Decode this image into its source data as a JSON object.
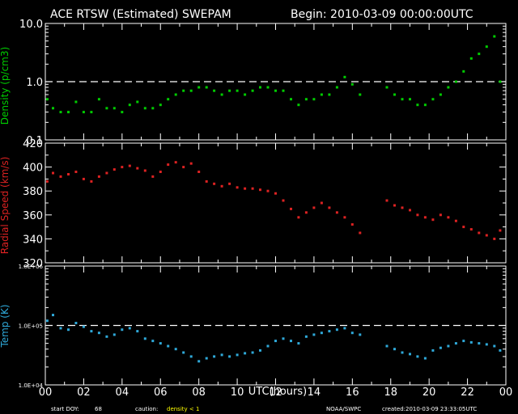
{
  "header": {
    "title": "ACE RTSW (Estimated) SWEPAM",
    "begin": "Begin: 2010-03-09 00:00:00UTC"
  },
  "footer": {
    "start_doy_label": "start DOY:",
    "start_doy_value": "68",
    "caution_label": "caution:",
    "caution_value": "density < 1",
    "source": "NOAA/SWPC",
    "created": "created:2010-03-09 23:33:05UTC"
  },
  "colors": {
    "density": "#00cc00",
    "speed": "#dd2222",
    "temp": "#2fa9d9",
    "caution": "#ffff00",
    "axes": "#ffffff"
  },
  "chart_data": [
    {
      "type": "scatter",
      "ylabel": "Density (p/cm3)",
      "yscale": "log",
      "ylim": [
        0.1,
        10.0
      ],
      "yticks": [
        0.1,
        1.0,
        10.0
      ],
      "ytick_labels": [
        "0.1",
        "1.0",
        "10.0"
      ],
      "xlim": [
        0,
        24
      ],
      "reference_line": 1.0,
      "series": [
        {
          "x": [
            0.1,
            0.4,
            0.8,
            1.2,
            1.6,
            2.0,
            2.4,
            2.8,
            3.2,
            3.6,
            4.0,
            4.4,
            4.8,
            5.2,
            5.6,
            6.0,
            6.4,
            6.8,
            7.2,
            7.6,
            8.0,
            8.4,
            8.8,
            9.2,
            9.6,
            10.0,
            10.4,
            10.8,
            11.2,
            11.6,
            12.0,
            12.4,
            12.8,
            13.2,
            13.6,
            14.0,
            14.4,
            14.8,
            15.2,
            15.6,
            16.0,
            16.4,
            17.8,
            18.2,
            18.6,
            19.0,
            19.4,
            19.8,
            20.2,
            20.6,
            21.0,
            21.4,
            21.8,
            22.2,
            22.6,
            23.0,
            23.4,
            23.7
          ],
          "y": [
            0.5,
            0.35,
            0.3,
            0.3,
            0.45,
            0.3,
            0.3,
            0.5,
            0.35,
            0.35,
            0.3,
            0.4,
            0.45,
            0.35,
            0.35,
            0.4,
            0.5,
            0.6,
            0.7,
            0.7,
            0.8,
            0.8,
            0.7,
            0.6,
            0.7,
            0.7,
            0.6,
            0.7,
            0.8,
            0.8,
            0.7,
            0.7,
            0.5,
            0.4,
            0.5,
            0.5,
            0.6,
            0.6,
            0.8,
            1.2,
            0.9,
            0.6,
            0.8,
            0.6,
            0.5,
            0.5,
            0.4,
            0.4,
            0.5,
            0.6,
            0.8,
            1.0,
            1.5,
            2.5,
            3.0,
            4.0,
            6.0,
            1.0
          ]
        }
      ]
    },
    {
      "type": "scatter",
      "ylabel": "Radial Speed (km/s)",
      "ylim": [
        320,
        420
      ],
      "yticks": [
        320,
        340,
        360,
        380,
        400,
        420
      ],
      "xlim": [
        0,
        24
      ],
      "series": [
        {
          "x": [
            0.1,
            0.4,
            0.8,
            1.2,
            1.6,
            2.0,
            2.4,
            2.8,
            3.2,
            3.6,
            4.0,
            4.4,
            4.8,
            5.2,
            5.6,
            6.0,
            6.4,
            6.8,
            7.2,
            7.6,
            8.0,
            8.4,
            8.8,
            9.2,
            9.6,
            10.0,
            10.4,
            10.8,
            11.2,
            11.6,
            12.0,
            12.4,
            12.8,
            13.2,
            13.6,
            14.0,
            14.4,
            14.8,
            15.2,
            15.6,
            16.0,
            16.4,
            17.8,
            18.2,
            18.6,
            19.0,
            19.4,
            19.8,
            20.2,
            20.6,
            21.0,
            21.4,
            21.8,
            22.2,
            22.6,
            23.0,
            23.4,
            23.7
          ],
          "y": [
            388,
            395,
            392,
            394,
            396,
            390,
            388,
            392,
            395,
            398,
            400,
            401,
            399,
            397,
            392,
            396,
            402,
            404,
            400,
            403,
            396,
            388,
            386,
            384,
            386,
            383,
            382,
            382,
            381,
            380,
            378,
            372,
            365,
            358,
            362,
            366,
            370,
            366,
            362,
            358,
            352,
            345,
            372,
            368,
            366,
            364,
            360,
            358,
            356,
            360,
            358,
            355,
            350,
            348,
            345,
            343,
            340,
            347
          ]
        }
      ]
    },
    {
      "type": "scatter",
      "ylabel": "Temp (K)",
      "yscale": "log",
      "ylim": [
        10000,
        1000000
      ],
      "yticks": [
        10000,
        100000,
        1000000
      ],
      "ytick_labels": [
        "1.0E+04",
        "1.0E+05",
        "1.0E+06"
      ],
      "xlim": [
        0,
        24
      ],
      "xlabel": "UTC(hours)",
      "xticks": [
        0,
        2,
        4,
        6,
        8,
        10,
        12,
        14,
        16,
        18,
        20,
        22,
        24
      ],
      "xtick_labels": [
        "00",
        "02",
        "04",
        "06",
        "08",
        "10",
        "12",
        "14",
        "16",
        "18",
        "20",
        "22",
        "00"
      ],
      "reference_line": 100000,
      "series": [
        {
          "x": [
            0.1,
            0.4,
            0.8,
            1.2,
            1.6,
            2.0,
            2.4,
            2.8,
            3.2,
            3.6,
            4.0,
            4.4,
            4.8,
            5.2,
            5.6,
            6.0,
            6.4,
            6.8,
            7.2,
            7.6,
            8.0,
            8.4,
            8.8,
            9.2,
            9.6,
            10.0,
            10.4,
            10.8,
            11.2,
            11.6,
            12.0,
            12.4,
            12.8,
            13.2,
            13.6,
            14.0,
            14.4,
            14.8,
            15.2,
            15.6,
            16.0,
            16.4,
            17.8,
            18.2,
            18.6,
            19.0,
            19.4,
            19.8,
            20.2,
            20.6,
            21.0,
            21.4,
            21.8,
            22.2,
            22.6,
            23.0,
            23.4,
            23.7
          ],
          "y": [
            120000,
            150000,
            90000,
            85000,
            110000,
            95000,
            80000,
            75000,
            65000,
            70000,
            85000,
            90000,
            80000,
            60000,
            55000,
            50000,
            45000,
            40000,
            35000,
            30000,
            25000,
            28000,
            30000,
            32000,
            30000,
            32000,
            34000,
            35000,
            38000,
            45000,
            55000,
            60000,
            55000,
            50000,
            65000,
            70000,
            75000,
            80000,
            85000,
            90000,
            75000,
            70000,
            45000,
            40000,
            35000,
            33000,
            30000,
            28000,
            38000,
            42000,
            45000,
            50000,
            55000,
            52000,
            50000,
            48000,
            45000,
            38000
          ]
        }
      ]
    }
  ]
}
